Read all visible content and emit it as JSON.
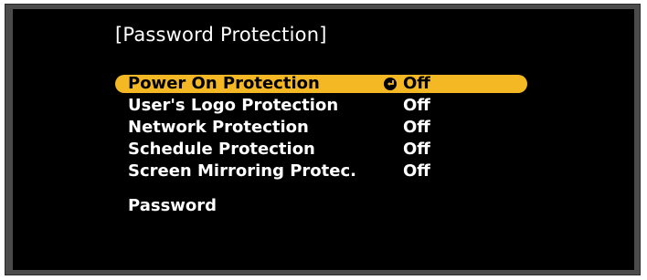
{
  "dialog": {
    "title": "[Password Protection]"
  },
  "menu": {
    "items": [
      {
        "label": "Power On Protection",
        "value": "Off",
        "selected": true,
        "icon": "enter-icon"
      },
      {
        "label": "User's Logo Protection",
        "value": "Off",
        "selected": false
      },
      {
        "label": "Network Protection",
        "value": "Off",
        "selected": false
      },
      {
        "label": "Schedule Protection",
        "value": "Off",
        "selected": false
      },
      {
        "label": "Screen Mirroring Protec.",
        "value": "Off",
        "selected": false
      }
    ],
    "password": {
      "label": "Password"
    }
  },
  "colors": {
    "highlight": "#f5b825",
    "background": "#000000",
    "frame": "#4b4b4b",
    "text": "#ffffff"
  }
}
